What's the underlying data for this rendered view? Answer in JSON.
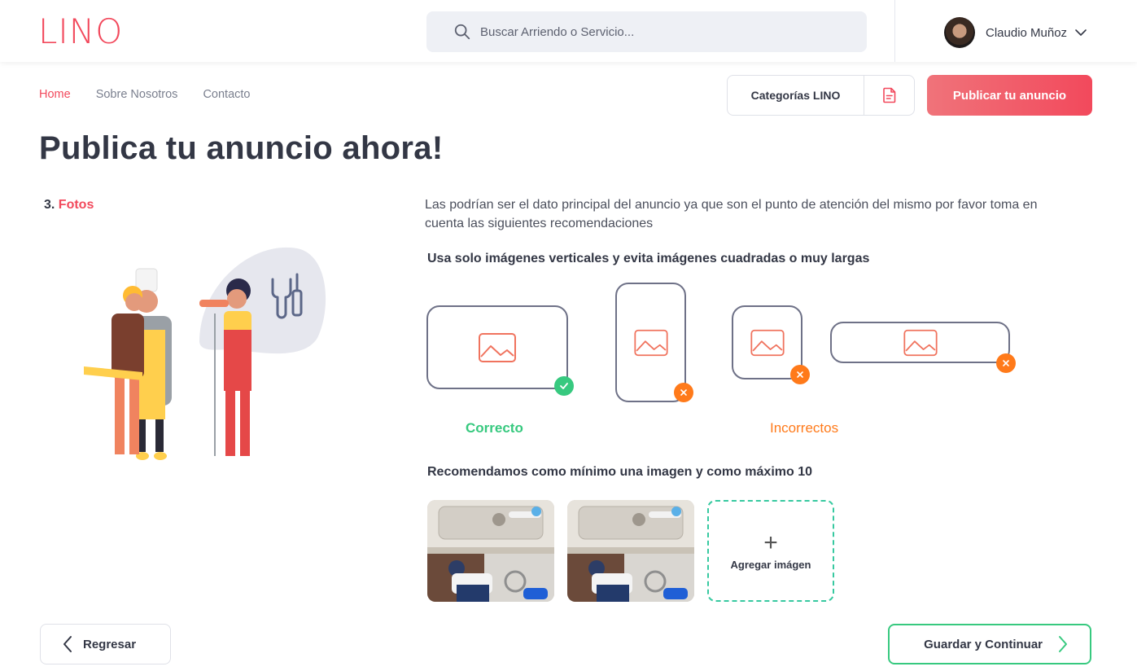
{
  "header": {
    "logo": "LINO",
    "search_placeholder": "Buscar Arriendo o Servicio...",
    "user_name": "Claudio Muñoz"
  },
  "nav": {
    "items": [
      "Home",
      "Sobre Nosotros",
      "Contacto"
    ],
    "categories_label": "Categorías LINO",
    "publish_label": "Publicar tu anuncio"
  },
  "main": {
    "title": "Publica tu anuncio ahora!",
    "step_number": "3.",
    "step_name": "Fotos",
    "intro": "Las podrían ser el dato principal del anuncio ya que son el punto de atención del mismo por favor toma en cuenta las siguientes recomendaciones",
    "rule_orientation": "Usa solo imágenes verticales y evita imágenes cuadradas o muy largas",
    "label_correct": "Correcto",
    "label_incorrect": "Incorrectos",
    "rule_count": "Recomendamos como mínimo una imagen y como máximo 10",
    "add_image_label": "Agregar imágen"
  },
  "footer": {
    "back_label": "Regresar",
    "next_label": "Guardar y Continuar"
  },
  "colors": {
    "brand": "#f2495c",
    "success": "#37c97f",
    "warning": "#ff7a1a",
    "text": "#333745"
  }
}
